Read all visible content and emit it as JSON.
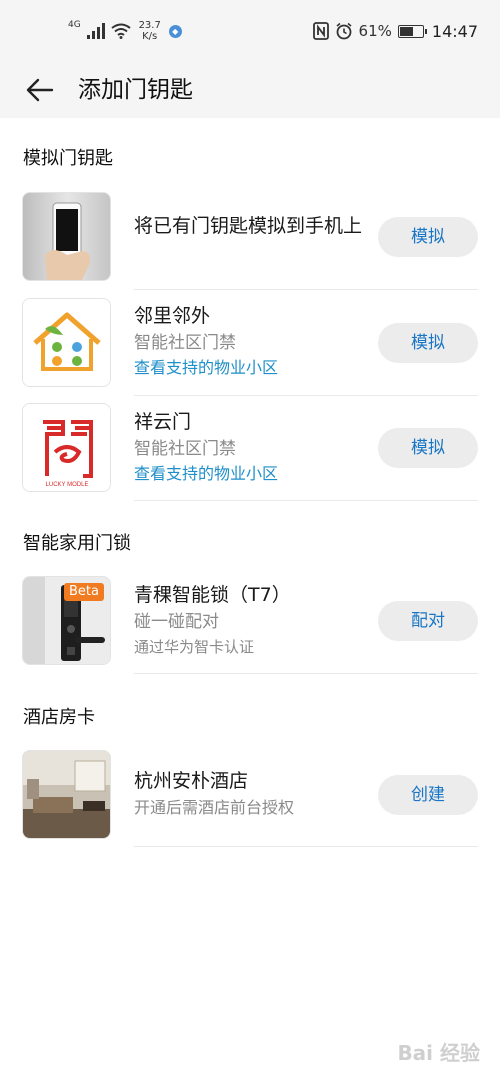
{
  "status_bar": {
    "network": "4G",
    "speed_value": "23.7",
    "speed_unit": "K/s",
    "battery": "61%",
    "battery_level": 0.61,
    "time": "14:47"
  },
  "header": {
    "title": "添加门钥匙"
  },
  "sections": {
    "simulate": {
      "title": "模拟门钥匙",
      "items": [
        {
          "name": "将已有门钥匙模拟到手机上",
          "button": "模拟"
        },
        {
          "name": "邻里邻外",
          "subtitle": "智能社区门禁",
          "link": "查看支持的物业小区",
          "button": "模拟"
        },
        {
          "name": "祥云门",
          "subtitle": "智能社区门禁",
          "link": "查看支持的物业小区",
          "button": "模拟",
          "logo_caption": "LUCKY MODLE"
        }
      ]
    },
    "smart_lock": {
      "title": "智能家用门锁",
      "items": [
        {
          "name": "青稞智能锁（T7）",
          "subtitle": "碰一碰配对",
          "note": "通过华为智卡认证",
          "button": "配对",
          "badge": "Beta"
        }
      ]
    },
    "hotel": {
      "title": "酒店房卡",
      "items": [
        {
          "name": "杭州安朴酒店",
          "subtitle": "开通后需酒店前台授权",
          "button": "创建"
        }
      ]
    }
  },
  "watermark": "Bai 经验",
  "colors": {
    "accent": "#1976c6",
    "link": "#1f8fc9",
    "badge": "#f07b20",
    "button_bg": "#ececec"
  }
}
